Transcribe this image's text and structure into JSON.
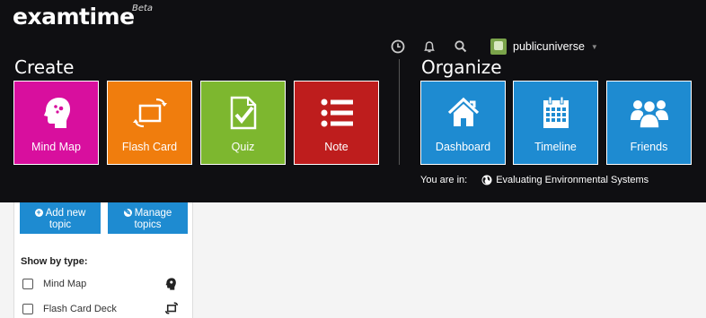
{
  "logo": {
    "text": "examtime",
    "badge": "Beta"
  },
  "header": {
    "icons": [
      "clock-icon",
      "bell-icon",
      "search-icon"
    ],
    "username": "publicuniverse"
  },
  "create": {
    "title": "Create",
    "tiles": [
      {
        "label": "Mind Map",
        "icon": "head-icon",
        "color": "#d80f9e"
      },
      {
        "label": "Flash Card",
        "icon": "flip-cards-icon",
        "color": "#f07d0d"
      },
      {
        "label": "Quiz",
        "icon": "checklist-doc-icon",
        "color": "#7db72f"
      },
      {
        "label": "Note",
        "icon": "bullet-list-icon",
        "color": "#be1d1d"
      }
    ]
  },
  "organize": {
    "title": "Organize",
    "tiles": [
      {
        "label": "Dashboard",
        "icon": "house-icon",
        "color": "#1e8bd1"
      },
      {
        "label": "Timeline",
        "icon": "calendar-icon",
        "color": "#1e8bd1"
      },
      {
        "label": "Friends",
        "icon": "group-icon",
        "color": "#1e8bd1"
      }
    ]
  },
  "location": {
    "prefix": "You are in:",
    "name": "Evaluating Environmental Systems"
  },
  "sidebar": {
    "add_topic": {
      "line1": "Add new",
      "line2": "topic"
    },
    "manage_topics": {
      "line1": "Manage",
      "line2": "topics"
    },
    "show_by_type": "Show by type:",
    "filters": [
      {
        "label": "Mind Map",
        "icon": "head-icon"
      },
      {
        "label": "Flash Card Deck",
        "icon": "flip-cards-icon"
      }
    ]
  }
}
